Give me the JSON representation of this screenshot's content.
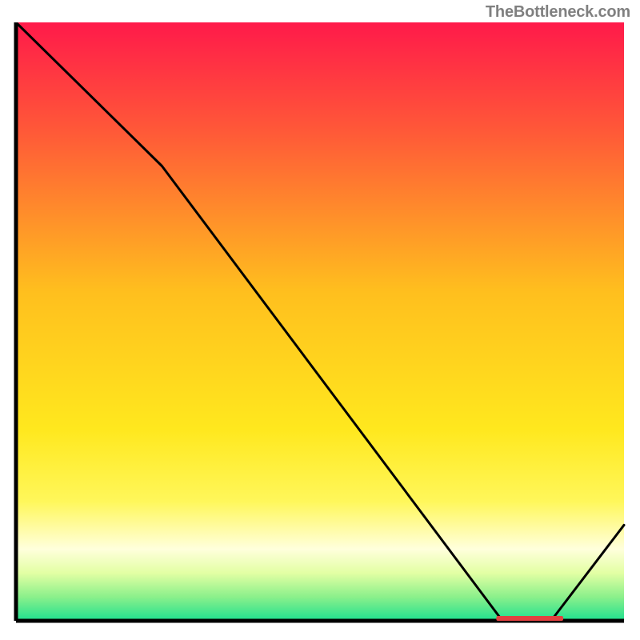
{
  "watermark": "TheBottleneck.com",
  "chart_data": {
    "type": "line",
    "xlim": [
      0,
      100
    ],
    "ylim": [
      0,
      100
    ],
    "x": [
      0,
      24,
      80,
      88,
      100
    ],
    "values": [
      100,
      76,
      0,
      0,
      16
    ],
    "marker": {
      "xStart": 79,
      "xEnd": 90,
      "y": 0.4
    },
    "gradient_stops": [
      {
        "offset": 0,
        "color": "#ff1a4a"
      },
      {
        "offset": 18,
        "color": "#ff5838"
      },
      {
        "offset": 45,
        "color": "#ffbf1e"
      },
      {
        "offset": 68,
        "color": "#ffe81e"
      },
      {
        "offset": 80,
        "color": "#fff75a"
      },
      {
        "offset": 88,
        "color": "#ffffdc"
      },
      {
        "offset": 92,
        "color": "#e3ffa4"
      },
      {
        "offset": 96,
        "color": "#8bf08b"
      },
      {
        "offset": 100,
        "color": "#1ee08f"
      }
    ],
    "title": "",
    "xlabel": "",
    "ylabel": ""
  }
}
